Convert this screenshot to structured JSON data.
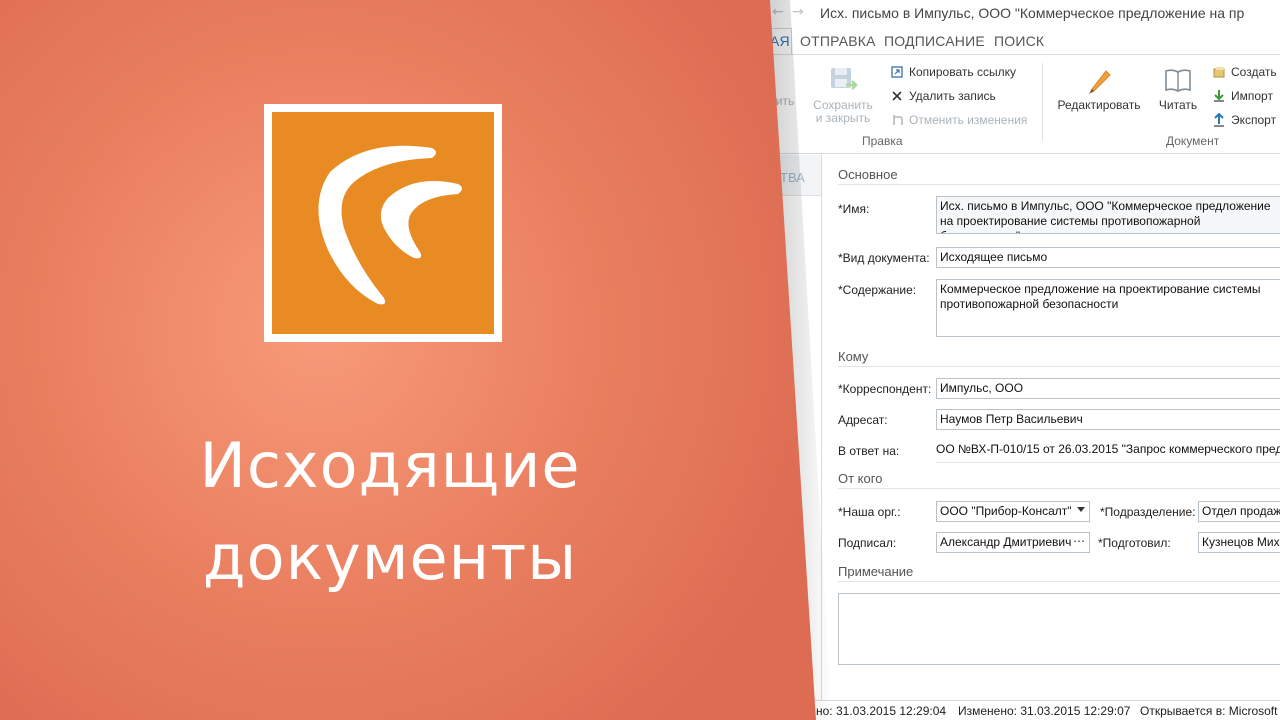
{
  "window": {
    "title": "Исх. письмо в Импульс, ООО \"Коммерческое предложение на пр"
  },
  "tabs": [
    {
      "label": "ГЛАВНАЯ",
      "visible_fragment": "АЯ",
      "active": true
    },
    {
      "label": "ОТПРАВКА",
      "visible_fragment": "ОТПРАВКА",
      "active": false
    },
    {
      "label": "ПОДПИСАНИЕ",
      "visible_fragment": "ПОДПИСАНИЕ",
      "active": false
    },
    {
      "label": "ПОИСК",
      "visible_fragment": "ПОИСК",
      "active": false
    }
  ],
  "ribbon": {
    "save_partial": "ить",
    "save_close": "Сохранить",
    "save_close_2": "и закрыть",
    "copy_link": "Копировать ссылку",
    "delete_record": "Удалить запись",
    "cancel_changes": "Отменить изменения",
    "group_edit": "Правка",
    "edit": "Редактировать",
    "read": "Читать",
    "group_document": "Документ",
    "create": "Создать",
    "import": "Импорт",
    "export": "Экспорт"
  },
  "left_panel": {
    "ghost_label": "ТВА"
  },
  "form": {
    "section_main": "Основное",
    "name_label": "*Имя:",
    "name_value": "Исх. письмо в Импульс, ООО \"Коммерческое предложение на проектирование системы противопожарной безопасности\"",
    "doctype_label": "*Вид документа:",
    "doctype_value": "Исходящее письмо",
    "content_label": "*Содержание:",
    "content_value": "Коммерческое предложение на проектирование системы противопожарной безопасности",
    "section_to": "Кому",
    "correspondent_label": "*Корреспондент:",
    "correspondent_value": "Импульс, ООО",
    "addressee_label": "Адресат:",
    "addressee_value": "Наумов Петр Васильевич",
    "reply_label": "В ответ на:",
    "reply_value": "ОО №ВХ-П-010/15 от 26.03.2015 \"Запрос коммерческого пред",
    "section_from": "От кого",
    "our_org_label": "*Наша орг.:",
    "our_org_value": "ООО \"Прибор-Консалт\"",
    "department_label": "*Подразделение:",
    "department_value": "Отдел продаж",
    "signed_label": "Подписал:",
    "signed_value": "Александр Дмитриевич",
    "prepared_label": "*Подготовил:",
    "prepared_value": "Кузнецов Миха",
    "section_note": "Примечание",
    "note_value": ""
  },
  "status": {
    "created": "но: 31.03.2015 12:29:04",
    "modified": "Изменено: 31.03.2015 12:29:07",
    "opens_in": "Открывается в: Microsoft"
  },
  "overlay": {
    "line1": "Исходящие",
    "line2": "документы",
    "panel_color": "#e5775a",
    "logo_color": "#e88b22"
  }
}
